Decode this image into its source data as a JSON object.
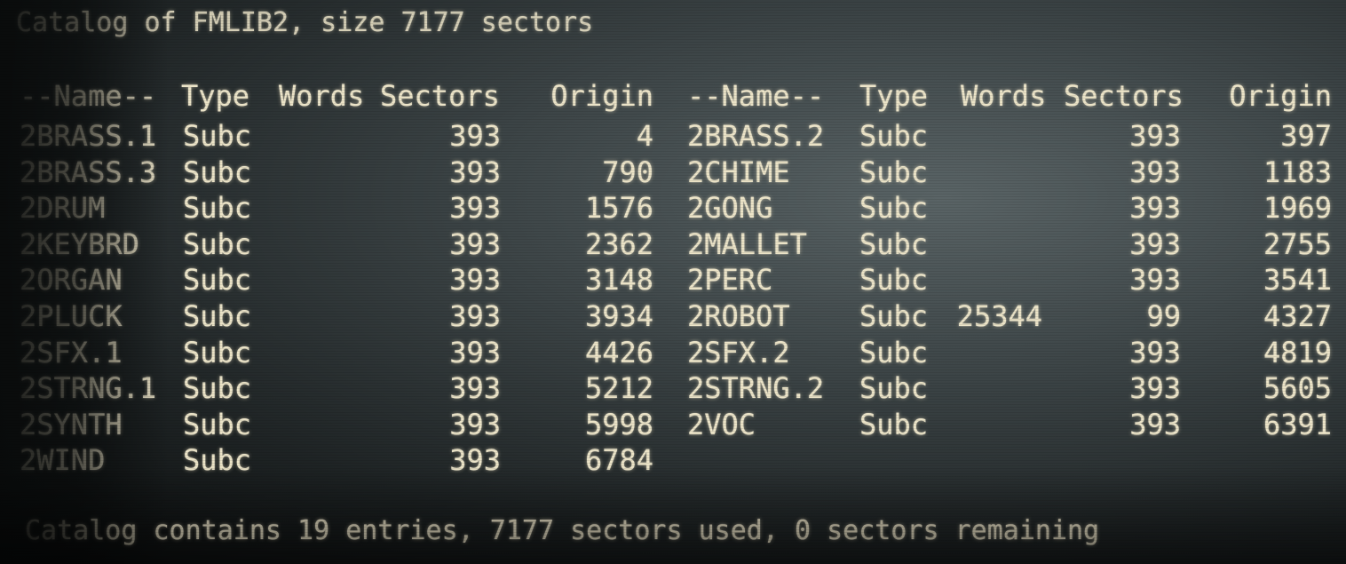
{
  "title": "Catalog of FMLIB2, size 7177 sectors",
  "headers": {
    "left": [
      "--Name--",
      "Type",
      "Words",
      "Sectors",
      "Origin"
    ],
    "right": [
      "--Name--",
      "Type",
      "Words",
      "Sectors",
      "Origin"
    ]
  },
  "left_rows": [
    {
      "name": "2BRASS.1",
      "type": "Subc",
      "words": "",
      "sectors": "393",
      "origin": "4"
    },
    {
      "name": "2BRASS.3",
      "type": "Subc",
      "words": "",
      "sectors": "393",
      "origin": "790"
    },
    {
      "name": "2DRUM",
      "type": "Subc",
      "words": "",
      "sectors": "393",
      "origin": "1576"
    },
    {
      "name": "2KEYBRD",
      "type": "Subc",
      "words": "",
      "sectors": "393",
      "origin": "2362"
    },
    {
      "name": "2ORGAN",
      "type": "Subc",
      "words": "",
      "sectors": "393",
      "origin": "3148"
    },
    {
      "name": "2PLUCK",
      "type": "Subc",
      "words": "",
      "sectors": "393",
      "origin": "3934"
    },
    {
      "name": "2SFX.1",
      "type": "Subc",
      "words": "",
      "sectors": "393",
      "origin": "4426"
    },
    {
      "name": "2STRNG.1",
      "type": "Subc",
      "words": "",
      "sectors": "393",
      "origin": "5212"
    },
    {
      "name": "2SYNTH",
      "type": "Subc",
      "words": "",
      "sectors": "393",
      "origin": "5998"
    },
    {
      "name": "2WIND",
      "type": "Subc",
      "words": "",
      "sectors": "393",
      "origin": "6784"
    }
  ],
  "right_rows": [
    {
      "name": "2BRASS.2",
      "type": "Subc",
      "words": "",
      "sectors": "393",
      "origin": "397"
    },
    {
      "name": "2CHIME",
      "type": "Subc",
      "words": "",
      "sectors": "393",
      "origin": "1183"
    },
    {
      "name": "2GONG",
      "type": "Subc",
      "words": "",
      "sectors": "393",
      "origin": "1969"
    },
    {
      "name": "2MALLET",
      "type": "Subc",
      "words": "",
      "sectors": "393",
      "origin": "2755"
    },
    {
      "name": "2PERC",
      "type": "Subc",
      "words": "",
      "sectors": "393",
      "origin": "3541"
    },
    {
      "name": "2ROBOT",
      "type": "Subc",
      "words": "25344",
      "sectors": "99",
      "origin": "4327"
    },
    {
      "name": "2SFX.2",
      "type": "Subc",
      "words": "",
      "sectors": "393",
      "origin": "4819"
    },
    {
      "name": "2STRNG.2",
      "type": "Subc",
      "words": "",
      "sectors": "393",
      "origin": "5605"
    },
    {
      "name": "2VOC",
      "type": "Subc",
      "words": "",
      "sectors": "393",
      "origin": "6391"
    }
  ],
  "footer": "Catalog contains 19 entries, 7177 sectors used, 0 sectors remaining",
  "colors": {
    "text": "#ece4c8",
    "background": "#3c4446"
  }
}
